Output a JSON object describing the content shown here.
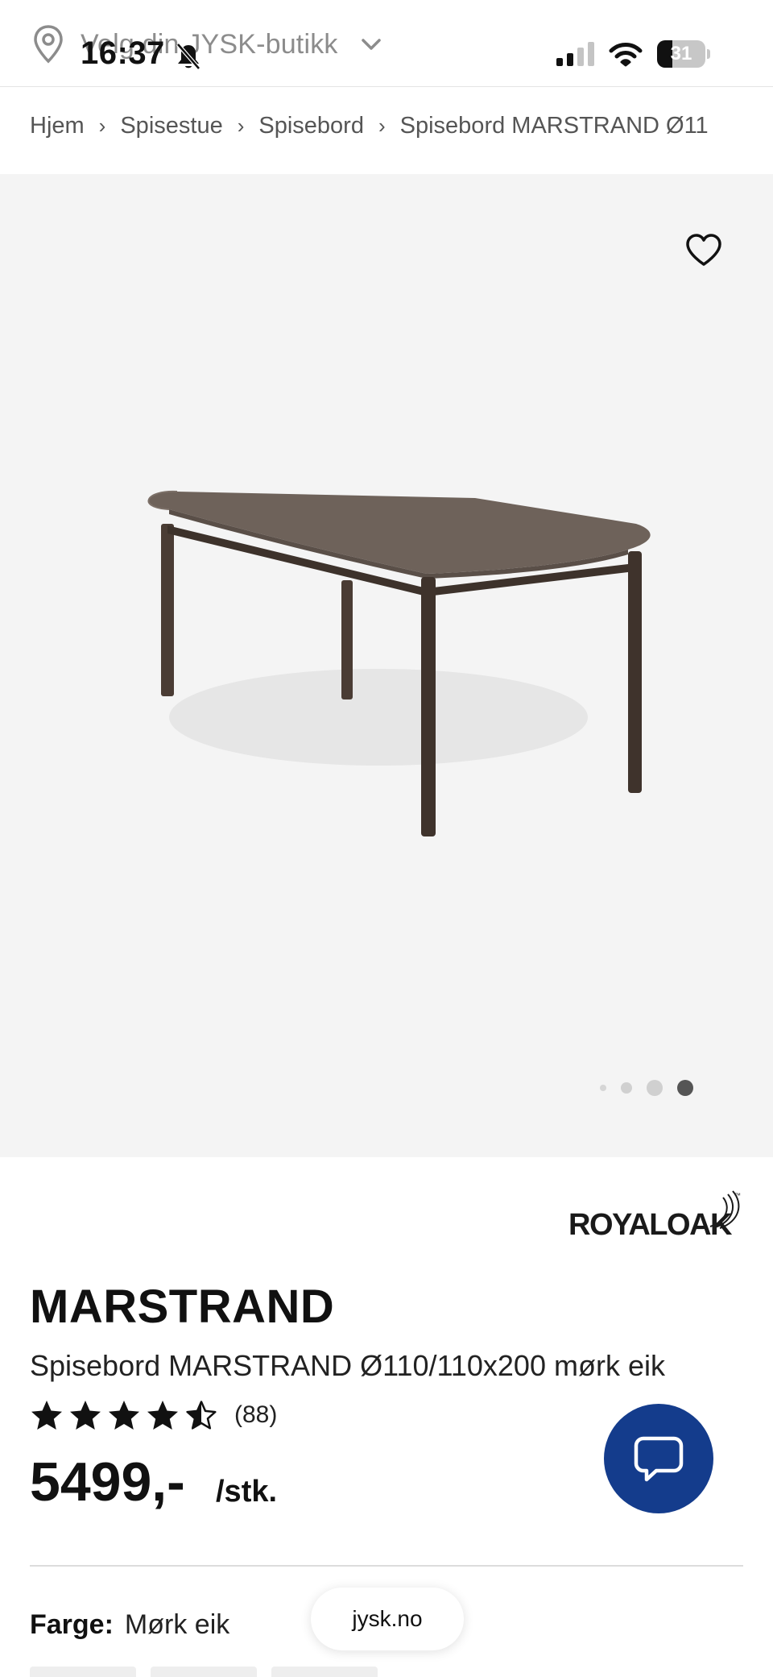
{
  "status_bar": {
    "time": "16:37",
    "battery": "31",
    "battery_level": 0.31
  },
  "header": {
    "store_label": "Velg din JYSK-butikk"
  },
  "breadcrumb": {
    "items": [
      "Hjem",
      "Spisestue",
      "Spisebord",
      "Spisebord MARSTRAND Ø11"
    ],
    "separator": "›"
  },
  "gallery": {
    "active_index": 3,
    "total": 4
  },
  "product": {
    "brand": "ROYALOAK",
    "brand_tm": "™",
    "name": "MARSTRAND",
    "subtitle": "Spisebord MARSTRAND Ø110/110x200 mørk eik",
    "rating": 4.5,
    "review_count": "(88)",
    "price": "5499,-",
    "unit": "/stk."
  },
  "options": {
    "color_label": "Farge:",
    "color_value": "Mørk eik"
  },
  "browser": {
    "url": "jysk.no"
  },
  "colors": {
    "accent": "#143c8c",
    "gallery_bg": "#f4f4f4",
    "table_wood": "#6e625a"
  },
  "icons": [
    "location-pin-icon",
    "chevron-down-icon",
    "bell-slash-icon",
    "signal-icon",
    "wifi-icon",
    "battery-icon",
    "heart-icon",
    "star-icon",
    "chat-bubble-icon"
  ]
}
